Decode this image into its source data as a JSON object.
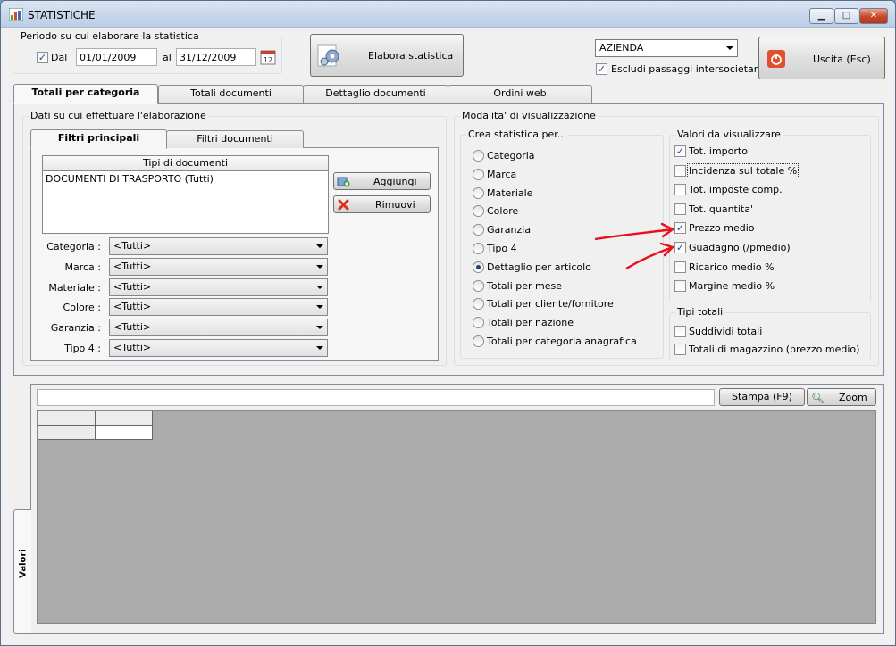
{
  "window": {
    "title": "STATISTICHE"
  },
  "period": {
    "label": "Periodo su cui elaborare la statistica",
    "from_checked": true,
    "from_label": "Dal",
    "from_value": "01/01/2009",
    "to_label": "al",
    "to_value": "31/12/2009"
  },
  "toolbar": {
    "elabora_label": "Elabora statistica",
    "company_value": "AZIENDA",
    "exclude_label": "Escludi passaggi intersocietari",
    "exclude_checked": true,
    "exit_label": "Uscita (Esc)"
  },
  "main_tabs": [
    "Totali per categoria",
    "Totali documenti",
    "Dettaglio documenti",
    "Ordini web"
  ],
  "data_group": {
    "title": "Dati su cui effettuare l'elaborazione",
    "subtabs": [
      "Filtri principali",
      "Filtri documenti"
    ],
    "list_header": "Tipi di documenti",
    "list_items": [
      "DOCUMENTI DI TRASPORTO (Tutti)"
    ],
    "add_label": "Aggiungi",
    "remove_label": "Rimuovi",
    "filters": [
      {
        "label": "Categoria :",
        "value": "<Tutti>"
      },
      {
        "label": "Marca :",
        "value": "<Tutti>"
      },
      {
        "label": "Materiale :",
        "value": "<Tutti>"
      },
      {
        "label": "Colore :",
        "value": "<Tutti>"
      },
      {
        "label": "Garanzia :",
        "value": "<Tutti>"
      },
      {
        "label": "Tipo 4 :",
        "value": "<Tutti>"
      }
    ]
  },
  "display": {
    "title": "Modalita' di visualizzazione",
    "create_title": "Crea statistica per...",
    "create_options": [
      {
        "label": "Categoria",
        "selected": false
      },
      {
        "label": "Marca",
        "selected": false
      },
      {
        "label": "Materiale",
        "selected": false
      },
      {
        "label": "Colore",
        "selected": false
      },
      {
        "label": "Garanzia",
        "selected": false
      },
      {
        "label": "Tipo 4",
        "selected": false
      },
      {
        "label": "Dettaglio per articolo",
        "selected": true
      },
      {
        "label": "Totali per mese",
        "selected": false
      },
      {
        "label": "Totali per cliente/fornitore",
        "selected": false
      },
      {
        "label": "Totali per nazione",
        "selected": false
      },
      {
        "label": "Totali per categoria anagrafica",
        "selected": false
      }
    ],
    "values_title": "Valori da visualizzare",
    "values": [
      {
        "label": "Tot. importo",
        "checked": true
      },
      {
        "label": "Incidenza sul totale %",
        "checked": false
      },
      {
        "label": "Tot. imposte comp.",
        "checked": false
      },
      {
        "label": "Tot. quantita'",
        "checked": false
      },
      {
        "label": "Prezzo medio",
        "checked": true
      },
      {
        "label": "Guadagno (/pmedio)",
        "checked": true
      },
      {
        "label": "Ricarico medio %",
        "checked": false
      },
      {
        "label": "Margine medio %",
        "checked": false
      }
    ],
    "totals_title": "Tipi totali",
    "totals": [
      {
        "label": "Suddividi totali",
        "checked": false
      },
      {
        "label": "Totali di magazzino (prezzo medio)",
        "checked": false
      }
    ]
  },
  "results": {
    "side_tab": "Valori",
    "print_label": "Stampa (F9)",
    "zoom_label": "Zoom",
    "filter_value": ""
  },
  "colors": {
    "annotation_arrow": "#e8101a",
    "grid_area": "#ababab",
    "accent": "#1e3f86"
  }
}
